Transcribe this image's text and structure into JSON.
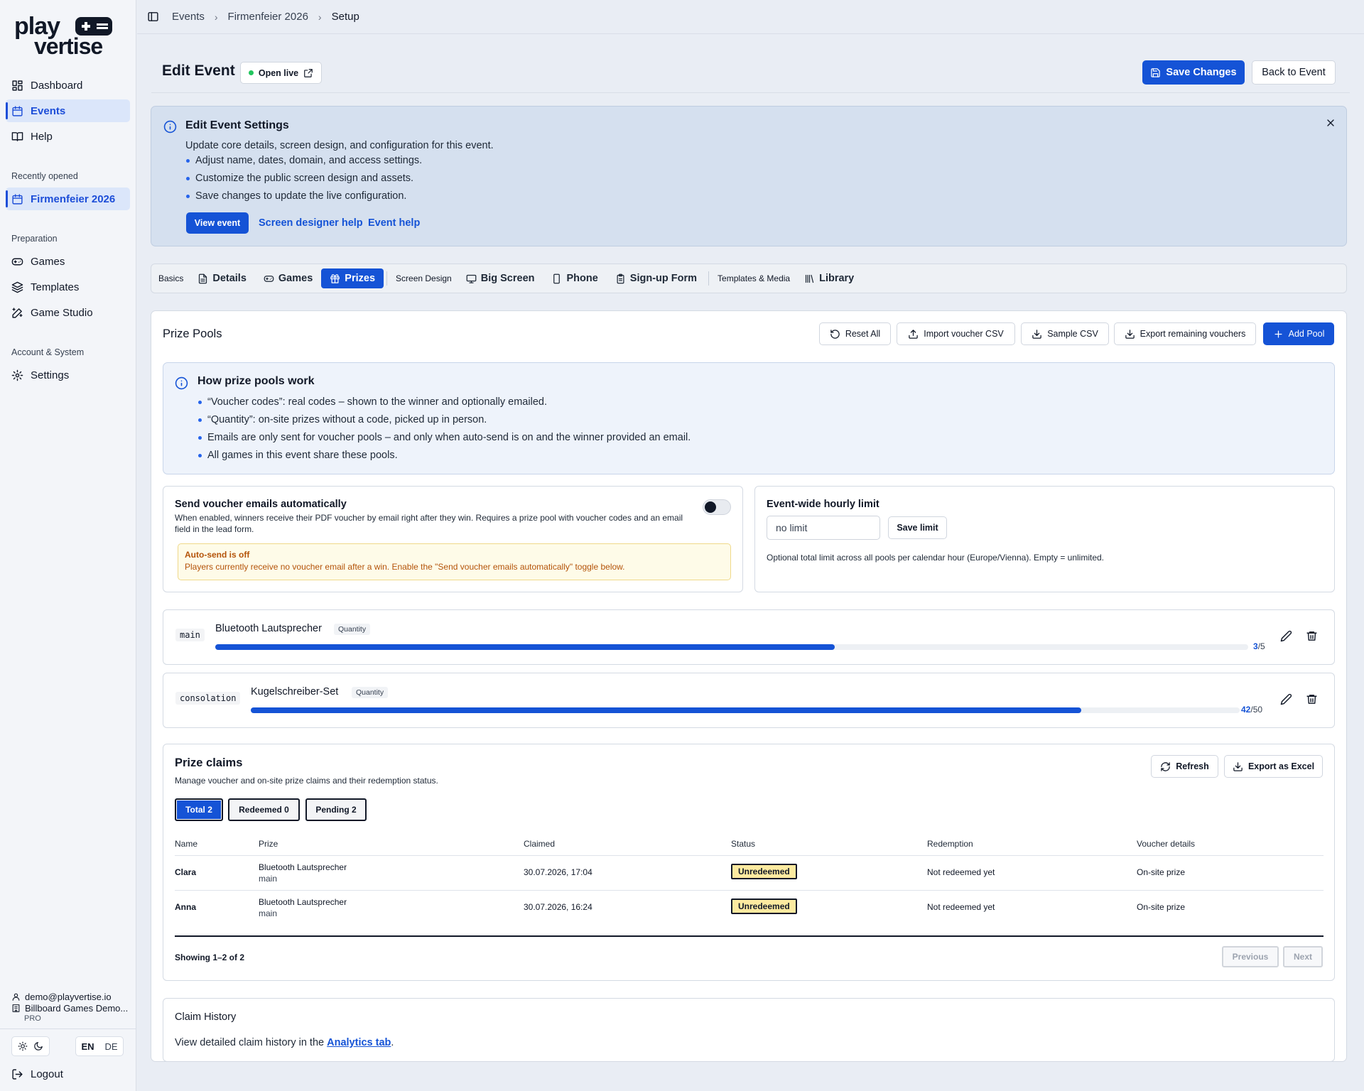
{
  "sidebar": {
    "logo": "playvertise",
    "nav": [
      {
        "label": "Dashboard",
        "icon": "dashboard-icon"
      },
      {
        "label": "Events",
        "icon": "calendar-icon",
        "active": true
      },
      {
        "label": "Help",
        "icon": "book-icon"
      }
    ],
    "recent_label": "Recently opened",
    "recent_item": "Firmenfeier 2026",
    "prep_label": "Preparation",
    "prep_items": [
      {
        "label": "Games",
        "icon": "gamepad-icon"
      },
      {
        "label": "Templates",
        "icon": "layers-icon"
      },
      {
        "label": "Game Studio",
        "icon": "wand-icon"
      }
    ],
    "account_label": "Account & System",
    "settings": "Settings",
    "user_email": "demo@playvertise.io",
    "org": "Billboard Games Demo...",
    "plan": "PRO",
    "lang_en": "EN",
    "lang_de": "DE",
    "logout": "Logout"
  },
  "breadcrumb": [
    "Events",
    "Firmenfeier 2026",
    "Setup"
  ],
  "header": {
    "title": "Edit Event",
    "open_live": "Open live",
    "save": "Save Changes",
    "back": "Back to Event"
  },
  "info": {
    "title": "Edit Event Settings",
    "desc": "Update core details, screen design, and configuration for this event.",
    "bullets": [
      "Adjust name, dates, domain, and access settings.",
      "Customize the public screen design and assets.",
      "Save changes to update the live configuration."
    ],
    "view_event": "View event",
    "designer_help": "Screen designer help",
    "event_help": "Event help"
  },
  "tabs": {
    "basics": "Basics",
    "details": "Details",
    "games": "Games",
    "prizes": "Prizes",
    "screen_design": "Screen Design",
    "big_screen": "Big Screen",
    "phone": "Phone",
    "signup": "Sign-up Form",
    "templates_media": "Templates & Media",
    "library": "Library"
  },
  "pools": {
    "title": "Prize Pools",
    "reset": "Reset All",
    "import": "Import voucher CSV",
    "sample": "Sample CSV",
    "export": "Export remaining vouchers",
    "add": "Add Pool",
    "how_title": "How prize pools work",
    "how_bullets": [
      "“Voucher codes”: real codes – shown to the winner and optionally emailed.",
      "“Quantity”: on-site prizes without a code, picked up in person.",
      "Emails are only sent for voucher pools – and only when auto-send is on and the winner provided an email.",
      "All games in this event share these pools."
    ],
    "auto_title": "Send voucher emails automatically",
    "auto_desc": "When enabled, winners receive their PDF voucher by email right after they win. Requires a prize pool with voucher codes and an email field in the lead form.",
    "auto_enabled": false,
    "warn_title": "Auto-send is off",
    "warn_desc": "Players currently receive no voucher email after a win. Enable the \"Send voucher emails automatically\" toggle below.",
    "limit_title": "Event-wide hourly limit",
    "limit_value": "no limit",
    "limit_save": "Save limit",
    "limit_desc": "Optional total limit across all pools per calendar hour (Europe/Vienna). Empty = unlimited.",
    "items": [
      {
        "code": "main",
        "name": "Bluetooth Lautsprecher",
        "type": "Quantity",
        "used": 3,
        "total": 5,
        "used_label": "3",
        "total_label": "/5"
      },
      {
        "code": "consolation",
        "name": "Kugelschreiber-Set",
        "type": "Quantity",
        "used": 42,
        "total": 50,
        "used_label": "42",
        "total_label": "/50"
      }
    ]
  },
  "claims": {
    "title": "Prize claims",
    "desc": "Manage voucher and on-site prize claims and their redemption status.",
    "refresh": "Refresh",
    "export": "Export as Excel",
    "filters": [
      "Total 2",
      "Redeemed 0",
      "Pending 2"
    ],
    "columns": [
      "Name",
      "Prize",
      "Claimed",
      "Status",
      "Redemption",
      "Voucher details"
    ],
    "rows": [
      {
        "name": "Clara",
        "prize": "Bluetooth Lautsprecher",
        "pool": "main",
        "claimed": "30.07.2026, 17:04",
        "status": "Unredeemed",
        "redemption": "Not redeemed yet",
        "voucher": "On-site prize"
      },
      {
        "name": "Anna",
        "prize": "Bluetooth Lautsprecher",
        "pool": "main",
        "claimed": "30.07.2026, 16:24",
        "status": "Unredeemed",
        "redemption": "Not redeemed yet",
        "voucher": "On-site prize"
      }
    ],
    "showing": "Showing 1–2 of 2",
    "prev": "Previous",
    "next": "Next"
  },
  "history": {
    "title": "Claim History",
    "text": "View detailed claim history in the ",
    "link": "Analytics tab",
    "end": "."
  },
  "colors": {
    "accent": "#1553d6",
    "warn": "#b45309",
    "status": "#fdeaa0"
  }
}
